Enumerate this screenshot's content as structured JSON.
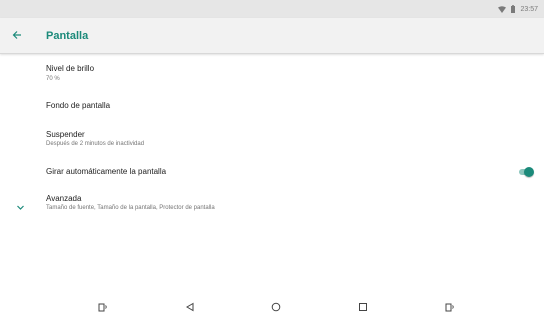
{
  "status_bar": {
    "time": "23:57"
  },
  "header": {
    "title": "Pantalla"
  },
  "settings": [
    {
      "title": "Nivel de brillo",
      "summary": "70 %"
    },
    {
      "title": "Fondo de pantalla"
    },
    {
      "title": "Suspender",
      "summary": "Después de 2 minutos de inactividad"
    },
    {
      "title": "Girar automáticamente la pantalla",
      "toggle_on": true
    },
    {
      "title": "Avanzada",
      "summary": "Tamaño de fuente, Tamaño de la pantalla, Protector de pantalla"
    }
  ],
  "colors": {
    "accent": "#1b8a7a",
    "toggle_track": "#8cc6bd",
    "status_bar_bg": "#e6e6e6",
    "app_bar_bg": "#f2f2f2"
  },
  "icons": {
    "status": [
      "wifi-icon",
      "battery-icon"
    ],
    "header": "back-arrow-icon",
    "advanced": "chevron-down-icon",
    "nav": [
      "screenshot-icon",
      "back-triangle-icon",
      "home-circle-icon",
      "recents-square-icon",
      "volume-icon"
    ]
  }
}
